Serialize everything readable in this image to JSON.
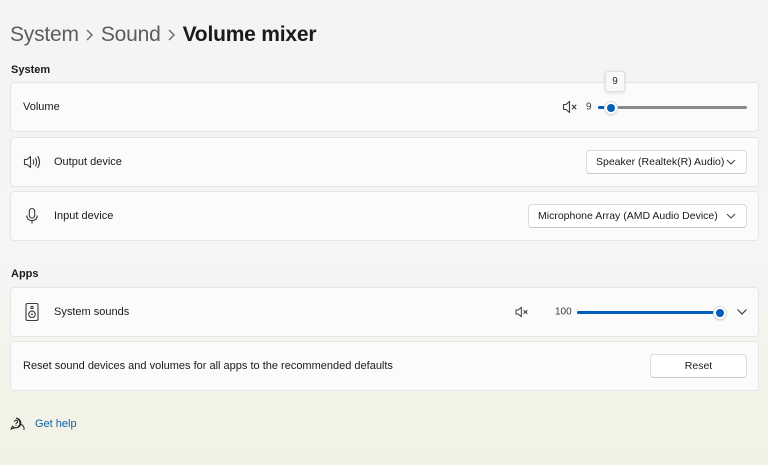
{
  "breadcrumb": {
    "items": [
      "System",
      "Sound"
    ],
    "current": "Volume mixer"
  },
  "system_section": {
    "title": "System",
    "volume": {
      "label": "Volume",
      "value": "9",
      "tooltip": "9",
      "level_percent": 9,
      "icon": "speaker-muted-icon"
    },
    "output_device": {
      "label": "Output device",
      "selected": "Speaker (Realtek(R) Audio)",
      "icon": "speaker-icon"
    },
    "input_device": {
      "label": "Input device",
      "selected": "Microphone Array (AMD Audio Device)",
      "icon": "microphone-icon"
    }
  },
  "apps_section": {
    "title": "Apps",
    "system_sounds": {
      "label": "System sounds",
      "value": "100",
      "level_percent": 100,
      "icon": "system-sounds-icon"
    },
    "reset": {
      "label": "Reset sound devices and volumes for all apps to the recommended defaults",
      "button_label": "Reset"
    }
  },
  "help": {
    "label": "Get help",
    "icon": "help-chat-icon"
  },
  "colors": {
    "accent": "#005fb8",
    "link": "#0f5fa6"
  }
}
